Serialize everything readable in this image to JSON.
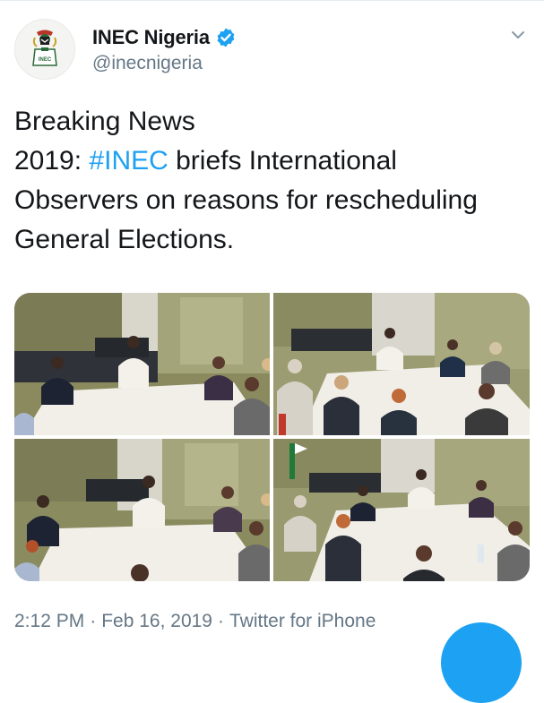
{
  "account": {
    "display_name": "INEC Nigeria",
    "handle": "@inecnigeria",
    "verified": true,
    "avatar_logo_text": "INEC"
  },
  "tweet": {
    "line1": "Breaking News",
    "line2_prefix": "2019: ",
    "hashtag": "#INEC",
    "line2_suffix": " briefs International",
    "line3": "Observers on reasons for rescheduling",
    "line4": "General Elections."
  },
  "meta": {
    "time": "2:12 PM",
    "date": "Feb 16, 2019",
    "source": "Twitter for iPhone",
    "separator": "·"
  },
  "icons": {
    "verified": "verified-badge-icon",
    "more": "chevron-down-icon",
    "compose": "compose-fab-icon"
  },
  "colors": {
    "accent": "#1da1f2",
    "text": "#14171a",
    "muted": "#657786"
  }
}
